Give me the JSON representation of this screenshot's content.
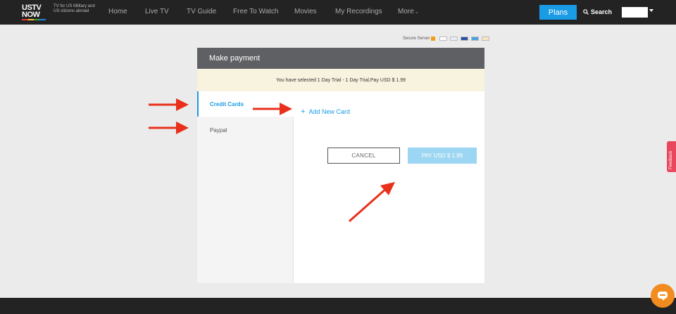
{
  "header": {
    "logo_line1": "USTV",
    "logo_line2": "NOW",
    "tagline": "TV for US Military and US citizens abroad",
    "nav": [
      "Home",
      "Live TV",
      "TV Guide",
      "Free To Watch",
      "Movies",
      "My Recordings",
      "More"
    ],
    "plans_label": "Plans",
    "search_label": "Search"
  },
  "secure_label": "Secure Server",
  "modal": {
    "title": "Make payment",
    "notice": "You have selected 1 Day Trial - 1 Day Trial,Pay USD $ 1.99",
    "tabs": [
      "Credit Cards",
      "Paypal"
    ],
    "active_tab": "Credit Cards",
    "add_card_icon": "+",
    "add_card_label": "Add New Card",
    "cancel_label": "CANCEL",
    "pay_label": "PAY USD $ 1.99"
  },
  "feedback_label": "Feedback",
  "colors": {
    "accent": "#1a9be6",
    "nav_bg": "#232323",
    "annotation_arrow": "#e8301a",
    "chat": "#f28c1f",
    "feedback": "#e9475d"
  }
}
